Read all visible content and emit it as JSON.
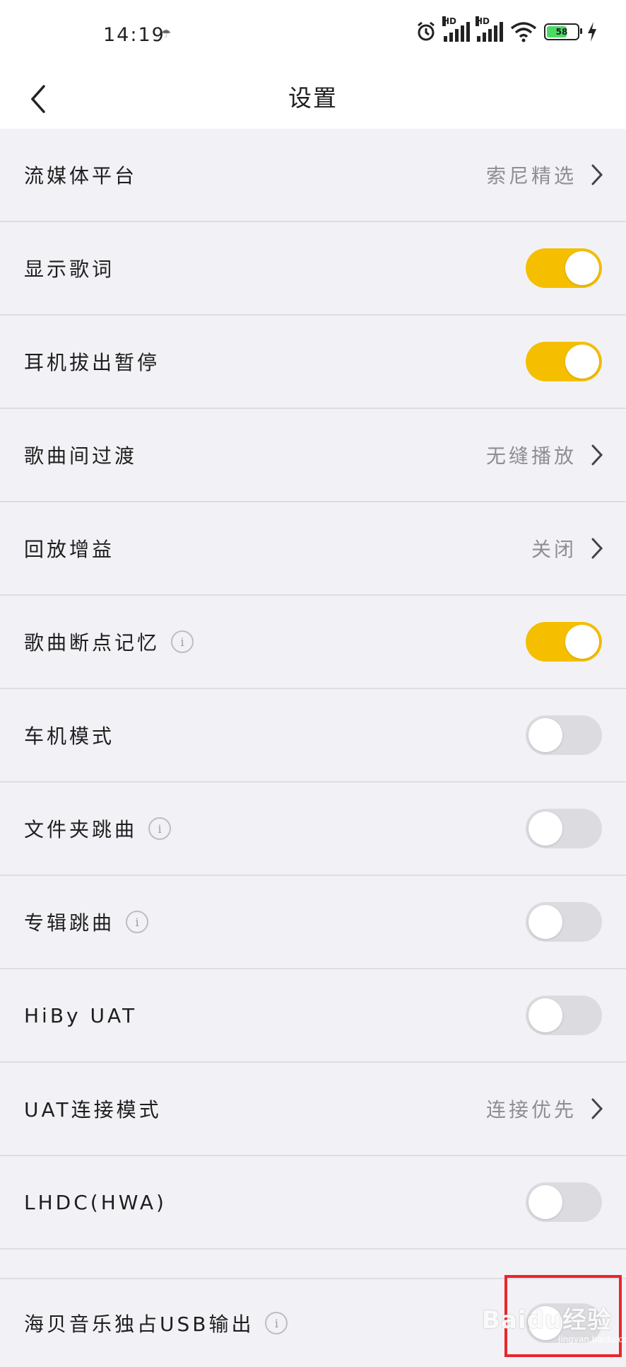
{
  "status_bar": {
    "time": "14:19",
    "hd_label": "HD",
    "battery": "58",
    "icons": [
      "alarm-icon",
      "signal-icon",
      "signal-icon",
      "wifi-icon",
      "battery-icon",
      "charging-icon"
    ]
  },
  "header": {
    "title": "设置",
    "back_icon": "chevron-left-icon"
  },
  "settings": {
    "items": [
      {
        "label": "流媒体平台",
        "value": "索尼精选",
        "type": "link"
      },
      {
        "label": "显示歌词",
        "type": "toggle",
        "on": true
      },
      {
        "label": "耳机拔出暂停",
        "type": "toggle",
        "on": true
      },
      {
        "label": "歌曲间过渡",
        "value": "无缝播放",
        "type": "link"
      },
      {
        "label": "回放增益",
        "value": "关闭",
        "type": "link"
      },
      {
        "label": "歌曲断点记忆",
        "info": true,
        "type": "toggle",
        "on": true
      },
      {
        "label": "车机模式",
        "type": "toggle",
        "on": false
      },
      {
        "label": "文件夹跳曲",
        "info": true,
        "type": "toggle",
        "on": false
      },
      {
        "label": "专辑跳曲",
        "info": true,
        "type": "toggle",
        "on": false
      },
      {
        "label": "HiBy UAT",
        "type": "toggle",
        "on": false
      },
      {
        "label": "UAT连接模式",
        "value": "连接优先",
        "type": "link"
      },
      {
        "label": "LHDC(HWA)",
        "type": "toggle",
        "on": false
      },
      {
        "label": "海贝音乐独占USB输出",
        "info": true,
        "type": "toggle",
        "on": false
      }
    ]
  },
  "info_glyph": "i",
  "watermark": {
    "text": "Baidu经验",
    "sub": "jingyan.baidu.com"
  },
  "colors": {
    "accent": "#f5bf00",
    "toggle_off": "#dcdce0",
    "background": "#f2f2f6",
    "highlight": "#e8262b"
  }
}
